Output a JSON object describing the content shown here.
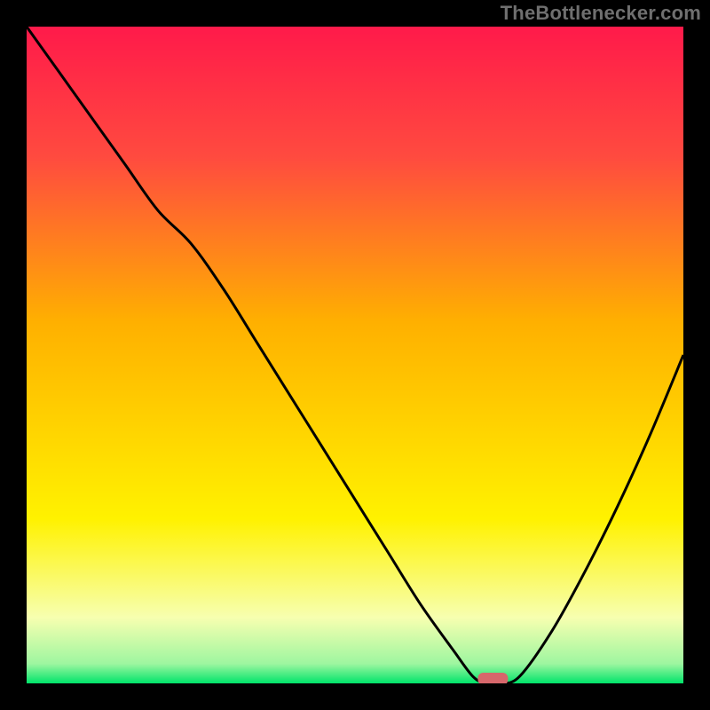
{
  "attribution": "TheBottlenecker.com",
  "chart_data": {
    "type": "line",
    "title": "",
    "xlabel": "",
    "ylabel": "",
    "xlim": [
      0,
      100
    ],
    "ylim": [
      0,
      100
    ],
    "x": [
      0,
      5,
      10,
      15,
      20,
      25,
      30,
      35,
      40,
      45,
      50,
      55,
      60,
      65,
      68,
      70,
      72,
      75,
      80,
      85,
      90,
      95,
      100
    ],
    "values": [
      100,
      93,
      86,
      79,
      72,
      67,
      60,
      52,
      44,
      36,
      28,
      20,
      12,
      5,
      1,
      0,
      0,
      1,
      8,
      17,
      27,
      38,
      50
    ],
    "marker": {
      "x": 71,
      "y": 0,
      "color": "#d7676b"
    },
    "gradient_stops": [
      {
        "offset": 0.0,
        "color": "#ff1a4a"
      },
      {
        "offset": 0.2,
        "color": "#ff4b3f"
      },
      {
        "offset": 0.45,
        "color": "#ffb000"
      },
      {
        "offset": 0.75,
        "color": "#fff200"
      },
      {
        "offset": 0.9,
        "color": "#f7ffb0"
      },
      {
        "offset": 0.97,
        "color": "#9ef6a0"
      },
      {
        "offset": 1.0,
        "color": "#00e46a"
      }
    ]
  }
}
